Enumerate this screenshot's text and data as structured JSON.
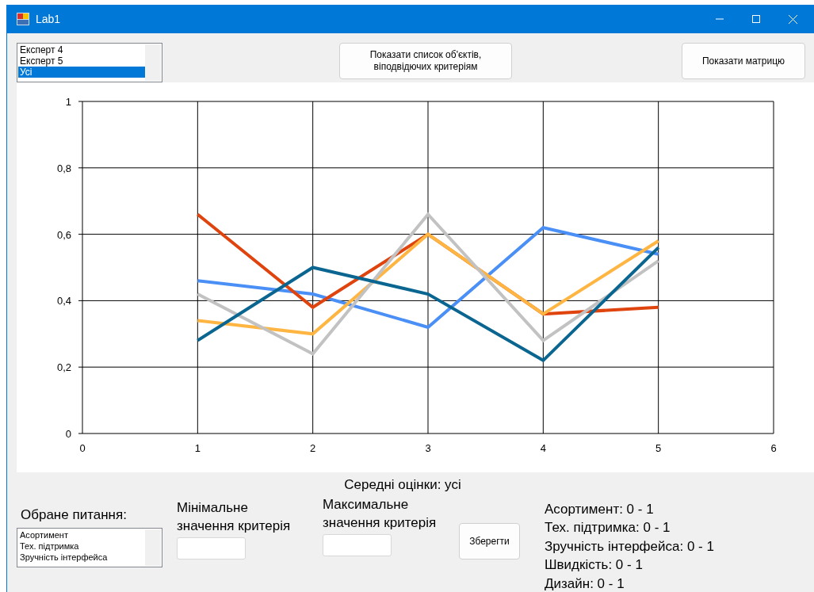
{
  "window": {
    "title": "Lab1"
  },
  "experts_list": {
    "items": [
      {
        "label": "Експерт 4",
        "selected": false
      },
      {
        "label": "Експерт 5",
        "selected": false
      },
      {
        "label": "Усі",
        "selected": true
      }
    ]
  },
  "buttons_top": [
    "Показати список об'єктів,\nвіподвідючих критеріям",
    "Показати матрицю"
  ],
  "chart": {
    "chart_data": {
      "type": "line",
      "grid": true,
      "x": [
        1,
        2,
        3,
        4,
        5
      ],
      "xlim": [
        0,
        6
      ],
      "ylim": [
        0,
        1
      ],
      "xticks": [
        0,
        1,
        2,
        3,
        4,
        5,
        6
      ],
      "yticks": [
        {
          "value": 0,
          "label": "0"
        },
        {
          "value": 0.2,
          "label": "0,2"
        },
        {
          "value": 0.4,
          "label": "0,4"
        },
        {
          "value": 0.6,
          "label": "0,6"
        },
        {
          "value": 0.8,
          "label": "0,8"
        },
        {
          "value": 1,
          "label": "1"
        }
      ],
      "series": [
        {
          "color": "#4a8ff5",
          "values": [
            0.46,
            0.42,
            0.32,
            0.62,
            0.54
          ]
        },
        {
          "color": "#e0440e",
          "values": [
            0.66,
            0.38,
            0.6,
            0.36,
            0.38
          ]
        },
        {
          "color": "#ffb541",
          "values": [
            0.34,
            0.3,
            0.6,
            0.36,
            0.58
          ]
        },
        {
          "color": "#c2c2c2",
          "values": [
            0.42,
            0.24,
            0.66,
            0.28,
            0.52
          ]
        },
        {
          "color": "#0a6690",
          "values": [
            0.28,
            0.5,
            0.42,
            0.22,
            0.56
          ]
        }
      ]
    }
  },
  "chart_caption": "Середні оцінки: усі",
  "question": {
    "label": "Обране питання:",
    "items": [
      {
        "label": "Асортимент",
        "selected": false
      },
      {
        "label": "Тех. підтримка",
        "selected": false
      },
      {
        "label": "Зручність інтерфейса",
        "selected": false
      }
    ]
  },
  "min_field": {
    "label": "Мінімальне значення критерія"
  },
  "max_field": {
    "label": "Максимальне значення критерія"
  },
  "save_button": "Зберегти",
  "ranges": [
    "Асортимент: 0 - 1",
    "Тех. підтримка: 0 - 1",
    "Зручність інтерфейса: 0 - 1",
    "Швидкість: 0 - 1",
    "Дизайн: 0 - 1"
  ]
}
